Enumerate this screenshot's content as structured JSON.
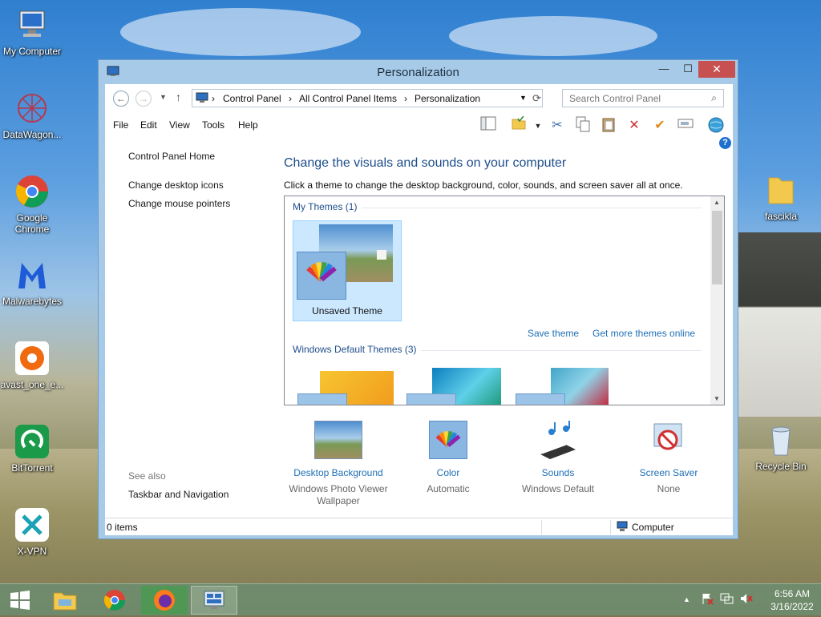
{
  "desktop": {
    "icons": [
      {
        "label": "My Computer"
      },
      {
        "label": "DataWagon..."
      },
      {
        "label": "Google Chrome"
      },
      {
        "label": "Malwarebytes"
      },
      {
        "label": "avast_one_e..."
      },
      {
        "label": "BitTorrent"
      },
      {
        "label": "X-VPN"
      },
      {
        "label": "fascikla"
      },
      {
        "label": "Recycle Bin"
      }
    ]
  },
  "window": {
    "title": "Personalization",
    "controls": {
      "minimize": "—",
      "maximize": "☐",
      "close": "✕"
    },
    "breadcrumb": [
      "Control Panel",
      "All Control Panel Items",
      "Personalization"
    ],
    "search_placeholder": "Search Control Panel",
    "menu": [
      "File",
      "Edit",
      "View",
      "Tools",
      "Help"
    ],
    "left_pane": {
      "home": "Control Panel Home",
      "links": [
        "Change desktop icons",
        "Change mouse pointers"
      ],
      "see_also_label": "See also",
      "see_also_links": [
        "Taskbar and Navigation"
      ]
    },
    "main": {
      "heading": "Change the visuals and sounds on your computer",
      "subtext": "Click a theme to change the desktop background, color, sounds, and screen saver all at once.",
      "my_themes_header": "My Themes (1)",
      "unsaved_theme": "Unsaved Theme",
      "save_theme": "Save theme",
      "get_more": "Get more themes online",
      "default_themes_header": "Windows Default Themes (3)"
    },
    "settings": [
      {
        "title": "Desktop Background",
        "subtitle": "Windows Photo Viewer Wallpaper"
      },
      {
        "title": "Color",
        "subtitle": "Automatic"
      },
      {
        "title": "Sounds",
        "subtitle": "Windows Default"
      },
      {
        "title": "Screen Saver",
        "subtitle": "None"
      }
    ],
    "status": {
      "items": "0 items",
      "location": "Computer"
    }
  },
  "taskbar": {
    "clock_time": "6:56 AM",
    "clock_date": "3/16/2022"
  },
  "colors": {
    "link": "#1e6fb5",
    "heading": "#1e4e8c",
    "close": "#c75050"
  }
}
